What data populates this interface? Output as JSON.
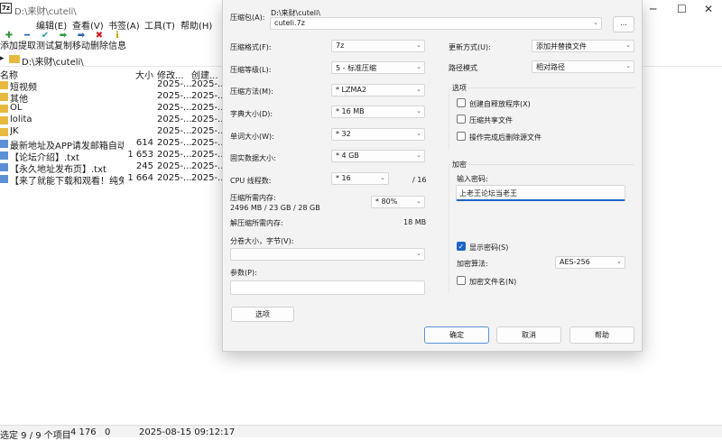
{
  "window": {
    "title_path": "D:\\来财\\cuteli\\",
    "app_icon": "7z"
  },
  "menu": [
    "编辑(E)",
    "查看(V)",
    "书签(A)",
    "工具(T)",
    "帮助(H)"
  ],
  "toolbar": [
    {
      "label": "添加",
      "icon": "plus-icon",
      "color": "#2e9a3a",
      "glyph": "✚"
    },
    {
      "label": "提取",
      "icon": "minus-icon",
      "color": "#2b5fb8",
      "glyph": "━"
    },
    {
      "label": "测试",
      "icon": "check-icon",
      "color": "#2aa0a0",
      "glyph": "✔"
    },
    {
      "label": "复制",
      "icon": "copy-arrow-icon",
      "color": "#2e9a3a",
      "glyph": "➡"
    },
    {
      "label": "移动",
      "icon": "move-arrow-icon",
      "color": "#2b5fb8",
      "glyph": "➡"
    },
    {
      "label": "删除",
      "icon": "delete-icon",
      "color": "#d02020",
      "glyph": "✖"
    },
    {
      "label": "信息",
      "icon": "info-icon",
      "color": "#c8a000",
      "glyph": "ℹ"
    }
  ],
  "address": "D:\\来财\\cuteli\\",
  "columns": {
    "name": "名称",
    "size": "大小",
    "modified": "修改...",
    "created": "创建..."
  },
  "files": [
    {
      "name": "短视频",
      "type": "folder",
      "size": "",
      "modified": "2025-...",
      "created": "2025-..."
    },
    {
      "name": "其他",
      "type": "folder",
      "size": "",
      "modified": "2025-...",
      "created": "2025-..."
    },
    {
      "name": "OL",
      "type": "folder",
      "size": "",
      "modified": "2025-...",
      "created": "2025-..."
    },
    {
      "name": "lolita",
      "type": "folder",
      "size": "",
      "modified": "2025-...",
      "created": "2025-..."
    },
    {
      "name": "JK",
      "type": "folder",
      "size": "",
      "modified": "2025-...",
      "created": "2025-..."
    },
    {
      "name": "最新地址及APP请发邮箱自动...",
      "type": "file",
      "size": "614",
      "modified": "2025-...",
      "created": "2025-..."
    },
    {
      "name": "【论坛介绍】.txt",
      "type": "file",
      "size": "1 653",
      "modified": "2025-...",
      "created": "2025-..."
    },
    {
      "name": "【永久地址发布页】.txt",
      "type": "file",
      "size": "245",
      "modified": "2025-...",
      "created": "2025-..."
    },
    {
      "name": "【来了就能下载和观看！纯免...",
      "type": "file",
      "size": "1 664",
      "modified": "2025-...",
      "created": "2025-..."
    }
  ],
  "status": {
    "selected": "选定 9 / 9 个项目",
    "size": "4 176",
    "count": "0",
    "datetime": "2025-08-15 09:12:17"
  },
  "dialog": {
    "archive_label": "压缩包(A):",
    "archive_dir": "D:\\来财\\cuteli\\",
    "archive_name": "cuteli.7z",
    "browse_label": "...",
    "format_label": "压缩格式(F):",
    "format_value": "7z",
    "level_label": "压缩等级(L):",
    "level_value": "5 - 标准压缩",
    "method_label": "压缩方法(M):",
    "method_value": "* LZMA2",
    "dict_label": "字典大小(D):",
    "dict_value": "* 16 MB",
    "word_label": "单词大小(W):",
    "word_value": "* 32",
    "solid_label": "固实数据大小:",
    "solid_value": "* 4 GB",
    "threads_label": "CPU 线程数:",
    "threads_value": "* 16",
    "threads_max": "/ 16",
    "mem_comp_label": "压缩所需内存:",
    "mem_comp_value": "2496 MB / 23 GB / 28 GB",
    "mem_percent": "* 80%",
    "mem_decomp_label": "解压缩所需内存:",
    "mem_decomp_value": "18 MB",
    "split_label": "分卷大小，字节(V):",
    "split_value": "",
    "params_label": "参数(P):",
    "params_value": "",
    "options_button": "选项",
    "update_label": "更新方式(U):",
    "update_value": "添加并替换文件",
    "path_mode_label": "路径模式",
    "path_mode_value": "相对路径",
    "options_group": "选项",
    "opt_sfx": "创建自释放程序(X)",
    "opt_shared": "压缩共享文件",
    "opt_delete": "操作完成后删除源文件",
    "encrypt_group": "加密",
    "password_label": "输入密码:",
    "password_value": "上老王论坛当老王",
    "show_password": "显示密码(S)",
    "enc_method_label": "加密算法:",
    "enc_method_value": "AES-256",
    "encrypt_names": "加密文件名(N)",
    "ok": "确定",
    "cancel": "取消",
    "help": "帮助"
  }
}
